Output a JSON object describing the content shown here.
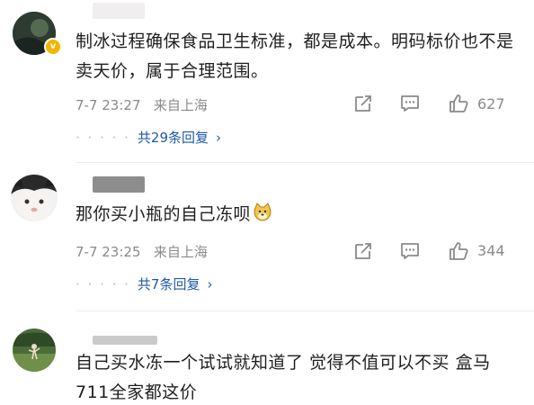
{
  "comments": [
    {
      "text": "制冰过程确保食品卫生标准，都是成本。明码标价也不是卖天价，属于合理范围。",
      "time": "7-7 23:27",
      "location": "来自上海",
      "likes": "627",
      "replies_label": "共29条回复",
      "badge": "v"
    },
    {
      "text": "那你买小瓶的自己冻呗",
      "time": "7-7 23:25",
      "location": "来自上海",
      "likes": "344",
      "replies_label": "共7条回复"
    },
    {
      "text": "自己买水冻一个试试就知道了 觉得不值可以不买 盒马711全家都这价"
    }
  ],
  "replies_prefix": "· · · · ·",
  "replies_chevron": "›",
  "icons": {
    "share": "share-icon",
    "comment": "comment-icon",
    "like": "thumbs-up-icon",
    "emoji": "doge-emoji-icon"
  },
  "colors": {
    "link": "#1e5aa8",
    "meta": "#8a8a8a",
    "text": "#1e1e1e",
    "badge": "#f5b400"
  }
}
